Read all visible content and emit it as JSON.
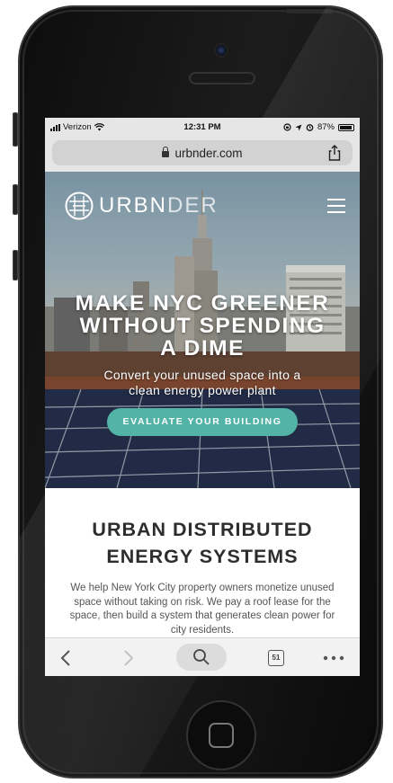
{
  "status_bar": {
    "carrier": "Verizon",
    "time": "12:31 PM",
    "battery": "87%"
  },
  "browser": {
    "url": "urbnder.com"
  },
  "hero": {
    "logo_text_bold": "URBN",
    "logo_text_light": "DER",
    "title_line1": "MAKE NYC GREENER",
    "title_line2": "WITHOUT SPENDING",
    "title_line3": "A DIME",
    "subtitle_line1": "Convert your unused space into a",
    "subtitle_line2": "clean energy power plant",
    "cta_label": "EVALUATE YOUR BUILDING"
  },
  "section": {
    "title_line1": "URBAN DISTRIBUTED",
    "title_line2": "ENERGY SYSTEMS",
    "body": "We help New York City property owners monetize unused space without taking on risk. We pay a roof lease for the space, then build a system that generates clean power for city residents."
  },
  "toolbar": {
    "tab_count": "51"
  },
  "colors": {
    "accent": "#52b3a6",
    "title_text": "#2d2d2d",
    "body_text": "#555555"
  }
}
